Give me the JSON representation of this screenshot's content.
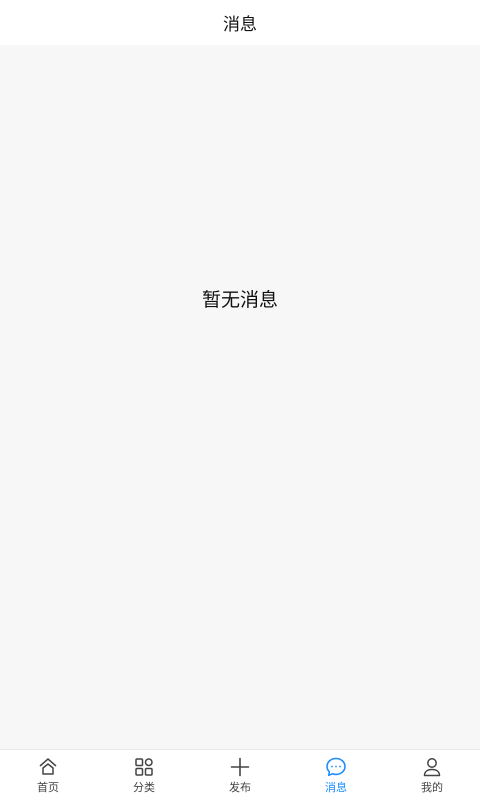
{
  "header": {
    "title": "消息"
  },
  "content": {
    "empty_text": "暂无消息"
  },
  "tabbar": {
    "active_color": "#1a8cff",
    "inactive_color": "#444444",
    "items": [
      {
        "label": "首页",
        "icon": "home-icon",
        "active": false
      },
      {
        "label": "分类",
        "icon": "grid-icon",
        "active": false
      },
      {
        "label": "发布",
        "icon": "plus-icon",
        "active": false
      },
      {
        "label": "消息",
        "icon": "chat-bubble-icon",
        "active": true
      },
      {
        "label": "我的",
        "icon": "user-icon",
        "active": false
      }
    ]
  }
}
